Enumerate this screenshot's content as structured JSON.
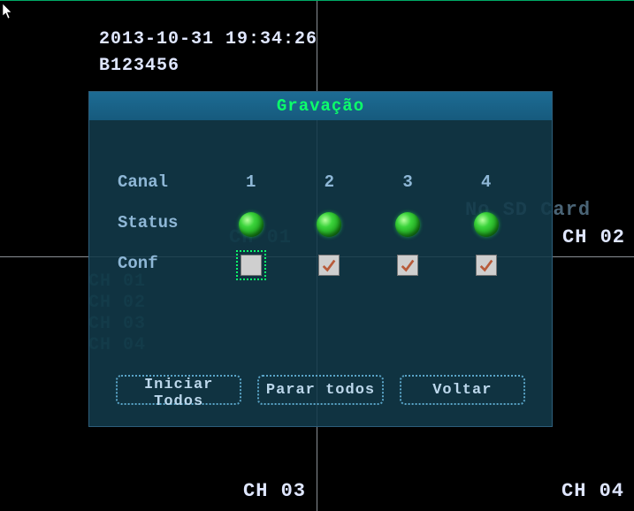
{
  "osd": {
    "timestamp": "2013-10-31 19:34:26",
    "device_id": "B123456"
  },
  "quadrants": {
    "q1_ghost": "CH 01",
    "q2": "CH 02",
    "q3": "CH 03",
    "q4": "CH 04"
  },
  "ghost_list": [
    "CH 01",
    "CH 02",
    "CH 03",
    "CH 04"
  ],
  "overlay_text": {
    "no_sd": "No SD Card"
  },
  "modal": {
    "title": "Gravação",
    "labels": {
      "channel": "Canal",
      "status": "Status",
      "conf": "Conf"
    },
    "channels": [
      "1",
      "2",
      "3",
      "4"
    ],
    "status": [
      "on",
      "on",
      "on",
      "on"
    ],
    "conf": [
      false,
      true,
      true,
      true
    ],
    "focus_conf_index": 0,
    "buttons": {
      "start_all": "Iniciar Todos",
      "stop_all": "Parar todos",
      "back": "Voltar"
    }
  }
}
